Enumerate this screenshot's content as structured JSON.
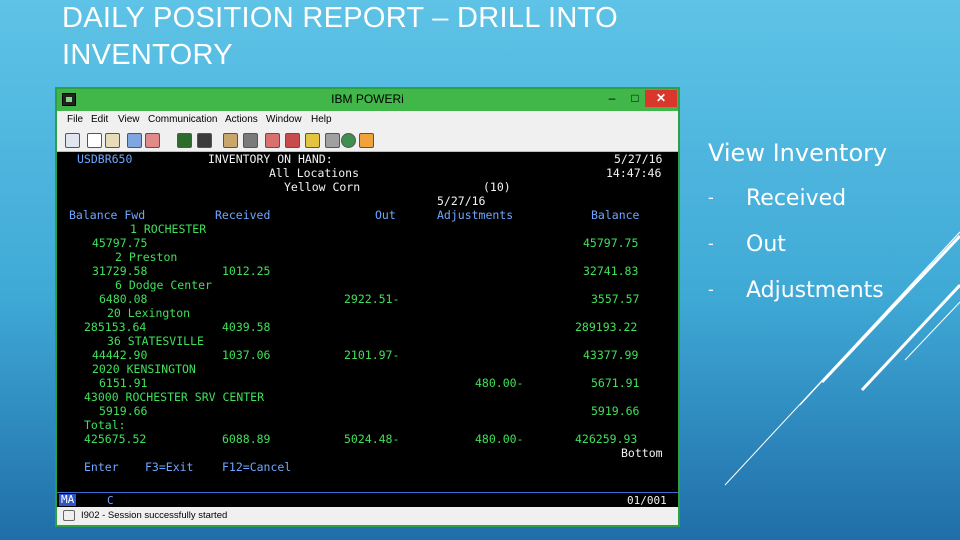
{
  "slide": {
    "title": "DAILY POSITION REPORT – DRILL INTO INVENTORY",
    "side_heading": "View Inventory",
    "bullets": [
      {
        "dash": "-",
        "label": "Received"
      },
      {
        "dash": "-",
        "label": "Out"
      },
      {
        "dash": "-",
        "label": "Adjustments"
      }
    ]
  },
  "window": {
    "title": "IBM POWERi",
    "minimize": "–",
    "maximize": "□",
    "close": "✕",
    "menu": [
      "File",
      "Edit",
      "View",
      "Communication",
      "Actions",
      "Window",
      "Help"
    ]
  },
  "toolbar_icons": [
    "print-icon",
    "copy-icon",
    "paste-icon",
    "send-icon",
    "receive-icon",
    "display-icon",
    "macro-record-icon",
    "macro-play-icon",
    "transfer-icon",
    "email-icon",
    "map-icon",
    "color-icon",
    "keyboard-icon",
    "globe-icon",
    "edit-icon"
  ],
  "screen": {
    "program": "USDBR650",
    "screen_title": "INVENTORY ON HAND:",
    "date": "5/27/16",
    "time": "14:47:46",
    "scope": "All Locations",
    "product": "Yellow Corn",
    "product_code": "(10)",
    "adj_date": "5/27/16",
    "headers": {
      "balance_fwd": "Balance Fwd",
      "received": "Received",
      "out": "Out",
      "adjustments": "Adjustments",
      "balance": "Balance"
    },
    "locations": [
      {
        "name": "1 ROCHESTER",
        "balance_fwd": "45797.75",
        "received": "",
        "out": "",
        "adjustments": "",
        "balance": "45797.75"
      },
      {
        "name": "2 Preston",
        "balance_fwd": "31729.58",
        "received": "1012.25",
        "out": "",
        "adjustments": "",
        "balance": "32741.83"
      },
      {
        "name": "6 Dodge Center",
        "balance_fwd": "6480.08",
        "received": "",
        "out": "2922.51-",
        "adjustments": "",
        "balance": "3557.57"
      },
      {
        "name": "20 Lexington",
        "balance_fwd": "285153.64",
        "received": "4039.58",
        "out": "",
        "adjustments": "",
        "balance": "289193.22"
      },
      {
        "name": "36 STATESVILLE",
        "balance_fwd": "44442.90",
        "received": "1037.06",
        "out": "2101.97-",
        "adjustments": "",
        "balance": "43377.99"
      },
      {
        "name": "2020 KENSINGTON",
        "balance_fwd": "6151.91",
        "received": "",
        "out": "",
        "adjustments": "480.00-",
        "balance": "5671.91"
      },
      {
        "name": "43000 ROCHESTER SRV CENTER",
        "balance_fwd": "5919.66",
        "received": "",
        "out": "",
        "adjustments": "",
        "balance": "5919.66"
      }
    ],
    "total": {
      "label": "Total:",
      "balance_fwd": "425675.52",
      "received": "6088.89",
      "out": "5024.48-",
      "adjustments": "480.00-",
      "balance": "426259.93"
    },
    "bottom_marker": "Bottom",
    "function_keys": {
      "enter": "Enter",
      "f3": "F3=Exit",
      "f12": "F12=Cancel"
    }
  },
  "oia": {
    "mode": "MA",
    "cursor_flag": "C",
    "position": "01/001"
  },
  "statusbar": {
    "text": "I902 - Session successfully started"
  },
  "colors": {
    "screen_text_green": "#3fe05a",
    "screen_text_blue": "#6fa6ff",
    "screen_text_white": "#f2f2f2",
    "window_frame": "#41b649",
    "close_button": "#d9362c",
    "slide_bg": "#3fa9d6"
  }
}
